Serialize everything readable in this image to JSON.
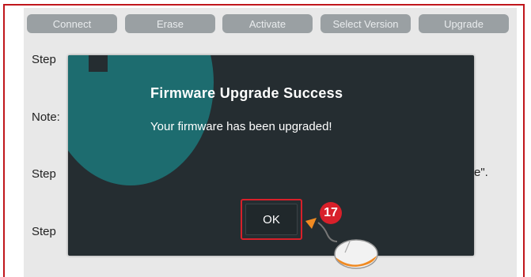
{
  "toolbar": {
    "buttons": [
      "Connect",
      "Erase",
      "Activate",
      "Select Version",
      "Upgrade"
    ]
  },
  "background": {
    "step1": "Step",
    "note": "Note:",
    "step2": "Step",
    "step2_trail": "e\".",
    "step3": "Step"
  },
  "dialog": {
    "title": "Firmware Upgrade Success",
    "message": "Your firmware has been upgraded!",
    "ok_label": "OK",
    "icon": "info-icon"
  },
  "annotation": {
    "step_number": "17",
    "icon": "mouse-icon"
  },
  "colors": {
    "frame": "#c0161c",
    "toolbar_button": "#9aa0a3",
    "dialog_bg": "#252d31",
    "dialog_accent": "#1d6c6f",
    "highlight": "#d8202a",
    "arrow": "#f08a22"
  }
}
